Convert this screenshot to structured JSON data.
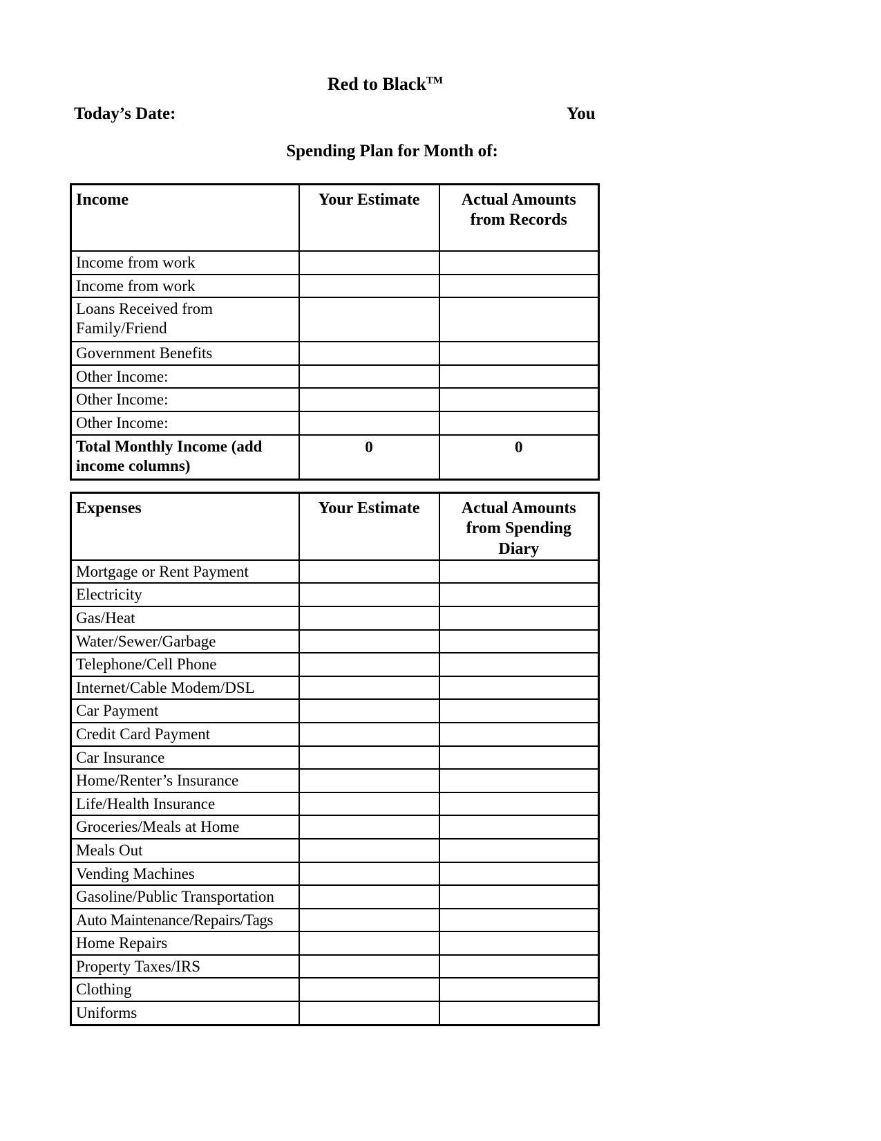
{
  "document": {
    "brand_name": "Red to Black",
    "brand_tm": "TM",
    "todays_date_label": "Today’s Date:",
    "you_label": "You",
    "plan_title": "Spending Plan for Month of:"
  },
  "income_table": {
    "headers": {
      "label": "Income",
      "estimate": "Your Estimate",
      "actual": "Actual Amounts from Records"
    },
    "rows": [
      {
        "label": "Income from work",
        "estimate": "",
        "actual": ""
      },
      {
        "label": "Income from work",
        "estimate": "",
        "actual": ""
      },
      {
        "label": "Loans Received from Family/Friend",
        "estimate": "",
        "actual": ""
      },
      {
        "label": "Government Benefits",
        "estimate": "",
        "actual": ""
      },
      {
        "label": "Other Income:",
        "estimate": "",
        "actual": ""
      },
      {
        "label": "Other Income:",
        "estimate": "",
        "actual": ""
      },
      {
        "label": "Other Income:",
        "estimate": "",
        "actual": ""
      }
    ],
    "total_row": {
      "label": "Total Monthly Income (add income columns)",
      "estimate": "0",
      "actual": "0"
    }
  },
  "expenses_table": {
    "headers": {
      "label": "Expenses",
      "estimate": "Your Estimate",
      "actual": "Actual Amounts from Spending Diary"
    },
    "rows": [
      {
        "label": "Mortgage or Rent Payment",
        "estimate": "",
        "actual": ""
      },
      {
        "label": "Electricity",
        "estimate": "",
        "actual": ""
      },
      {
        "label": "Gas/Heat",
        "estimate": "",
        "actual": ""
      },
      {
        "label": "Water/Sewer/Garbage",
        "estimate": "",
        "actual": ""
      },
      {
        "label": "Telephone/Cell Phone",
        "estimate": "",
        "actual": ""
      },
      {
        "label": "Internet/Cable Modem/DSL",
        "estimate": "",
        "actual": ""
      },
      {
        "label": "Car Payment",
        "estimate": "",
        "actual": ""
      },
      {
        "label": "Credit Card Payment",
        "estimate": "",
        "actual": ""
      },
      {
        "label": "Car Insurance",
        "estimate": "",
        "actual": ""
      },
      {
        "label": "Home/Renter’s Insurance",
        "estimate": "",
        "actual": ""
      },
      {
        "label": "Life/Health Insurance",
        "estimate": "",
        "actual": ""
      },
      {
        "label": "Groceries/Meals at Home",
        "estimate": "",
        "actual": ""
      },
      {
        "label": "Meals Out",
        "estimate": "",
        "actual": ""
      },
      {
        "label": "Vending Machines",
        "estimate": "",
        "actual": ""
      },
      {
        "label": "Gasoline/Public Transportation",
        "estimate": "",
        "actual": ""
      },
      {
        "label": "Auto Maintenance/Repairs/Tags",
        "estimate": "",
        "actual": ""
      },
      {
        "label": "Home Repairs",
        "estimate": "",
        "actual": ""
      },
      {
        "label": "Property Taxes/IRS",
        "estimate": "",
        "actual": ""
      },
      {
        "label": "Clothing",
        "estimate": "",
        "actual": ""
      },
      {
        "label": "Uniforms",
        "estimate": "",
        "actual": ""
      }
    ]
  },
  "colors": {
    "page_background": "#ffffff",
    "text": "#000000",
    "border": "#000000"
  }
}
